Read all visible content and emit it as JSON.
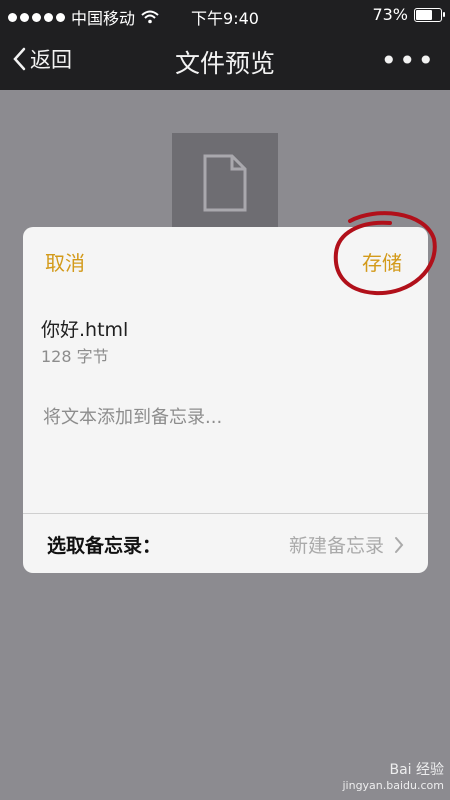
{
  "statusbar": {
    "carrier": "中国移动",
    "time": "下午9:40",
    "battery_text": "73%",
    "battery_level": 0.73
  },
  "navbar": {
    "back_label": "返回",
    "title": "文件预览",
    "more": "•••"
  },
  "sheet": {
    "cancel": "取消",
    "save": "存储",
    "file_name": "你好.html",
    "file_size": "128 字节",
    "note_placeholder": "将文本添加到备忘录...",
    "choose_label": "选取备忘录：",
    "choose_value": "新建备忘录"
  },
  "watermark": {
    "brand": "Bai 经验",
    "site": "jingyan.baidu.com"
  },
  "colors": {
    "accent": "#d39a1a",
    "annotation": "#b1101a",
    "background": "#8c8b90"
  },
  "icons": {
    "file": "document-icon",
    "back": "chevron-left-icon",
    "wifi": "wifi-icon",
    "chevron": "chevron-right-icon"
  }
}
